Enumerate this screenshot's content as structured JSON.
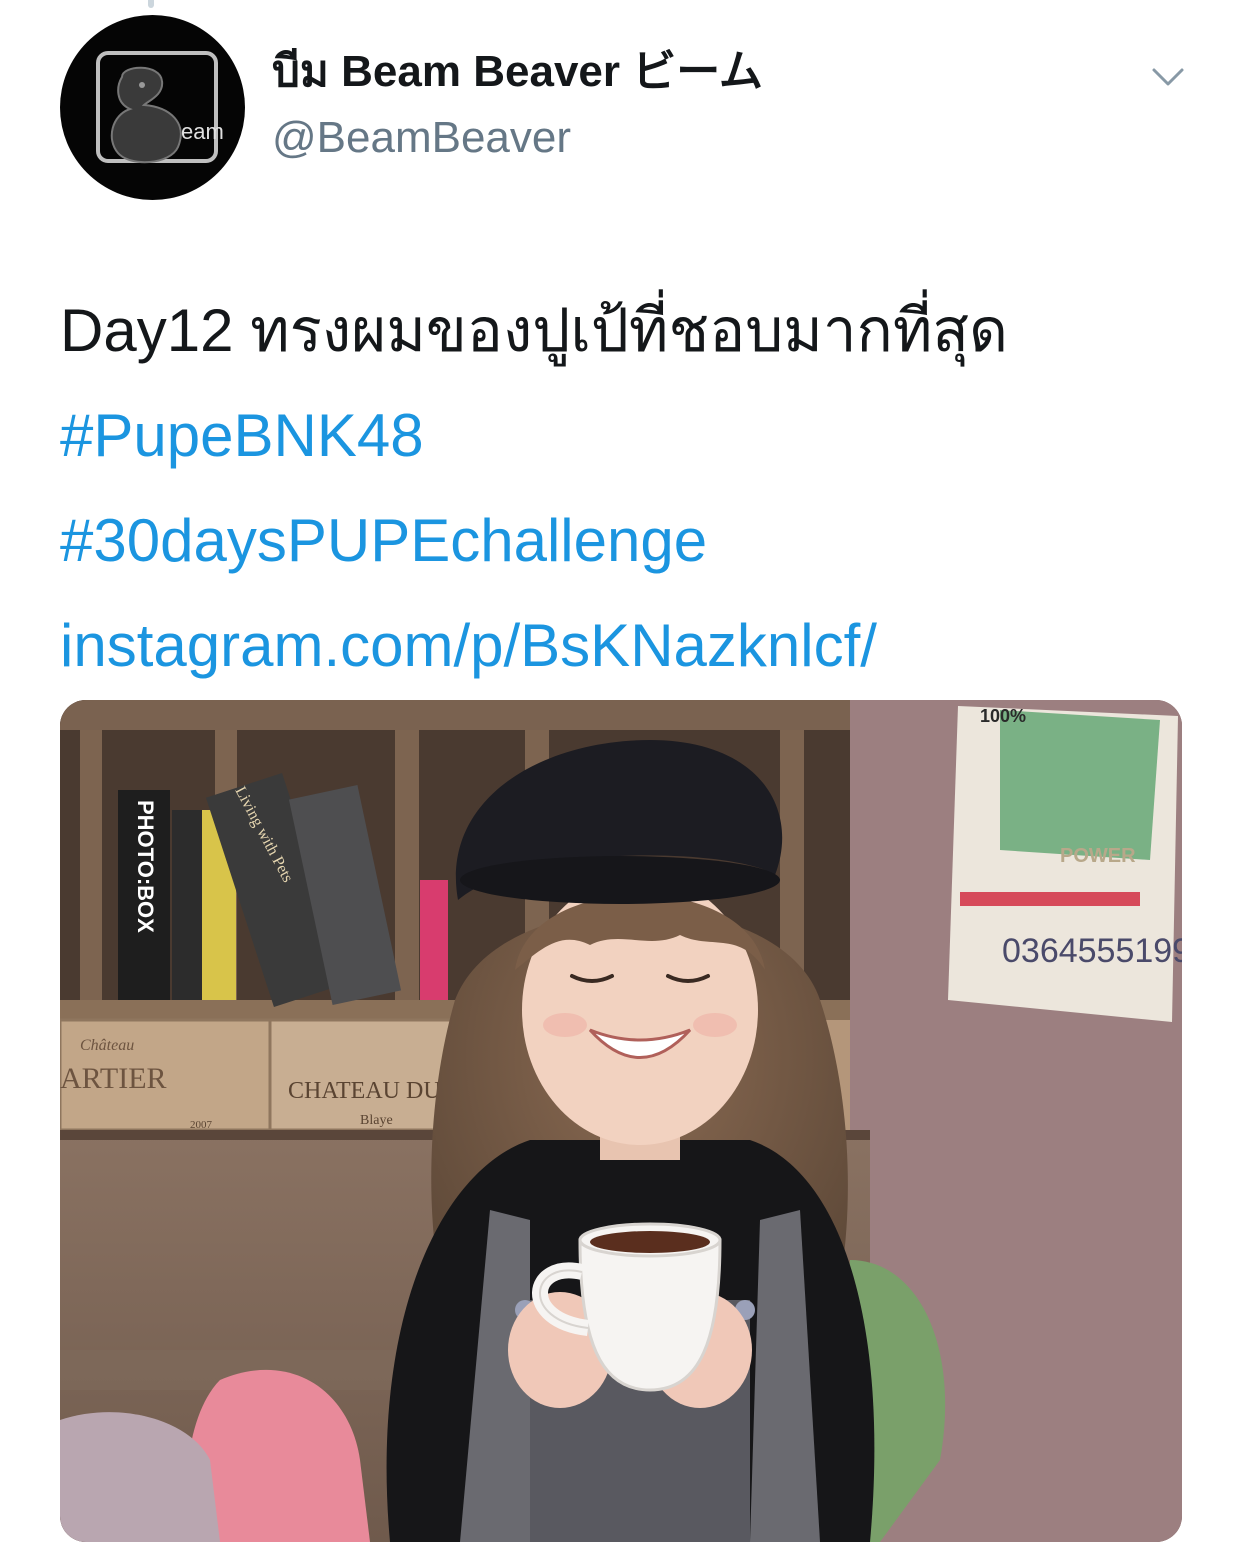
{
  "tweet": {
    "author": {
      "display_name": "บีม Beam Beaver ビーム",
      "handle": "@BeamBeaver",
      "avatar_text": "eam"
    },
    "text": "Day12 ทรงผมของปูเป้ที่ชอบมากที่สุด",
    "hashtags": [
      "#PupeBNK48",
      "#30daysPUPEchallenge"
    ],
    "link": "instagram.com/p/BsKNazknlcf/",
    "media": {
      "book_spines": [
        "PHOTO:BOX",
        "Living with Pets"
      ],
      "crate_texts": [
        "Château",
        "ARTIER",
        "CHATEAU DU",
        "Blaye",
        "2007"
      ],
      "poster_texts": [
        "100%",
        "POWER",
        "0364555199"
      ]
    }
  },
  "icons": {
    "chevron": "chevron-down-icon"
  },
  "colors": {
    "link": "#1b95e0",
    "text": "#14171a",
    "secondary": "#657786"
  }
}
